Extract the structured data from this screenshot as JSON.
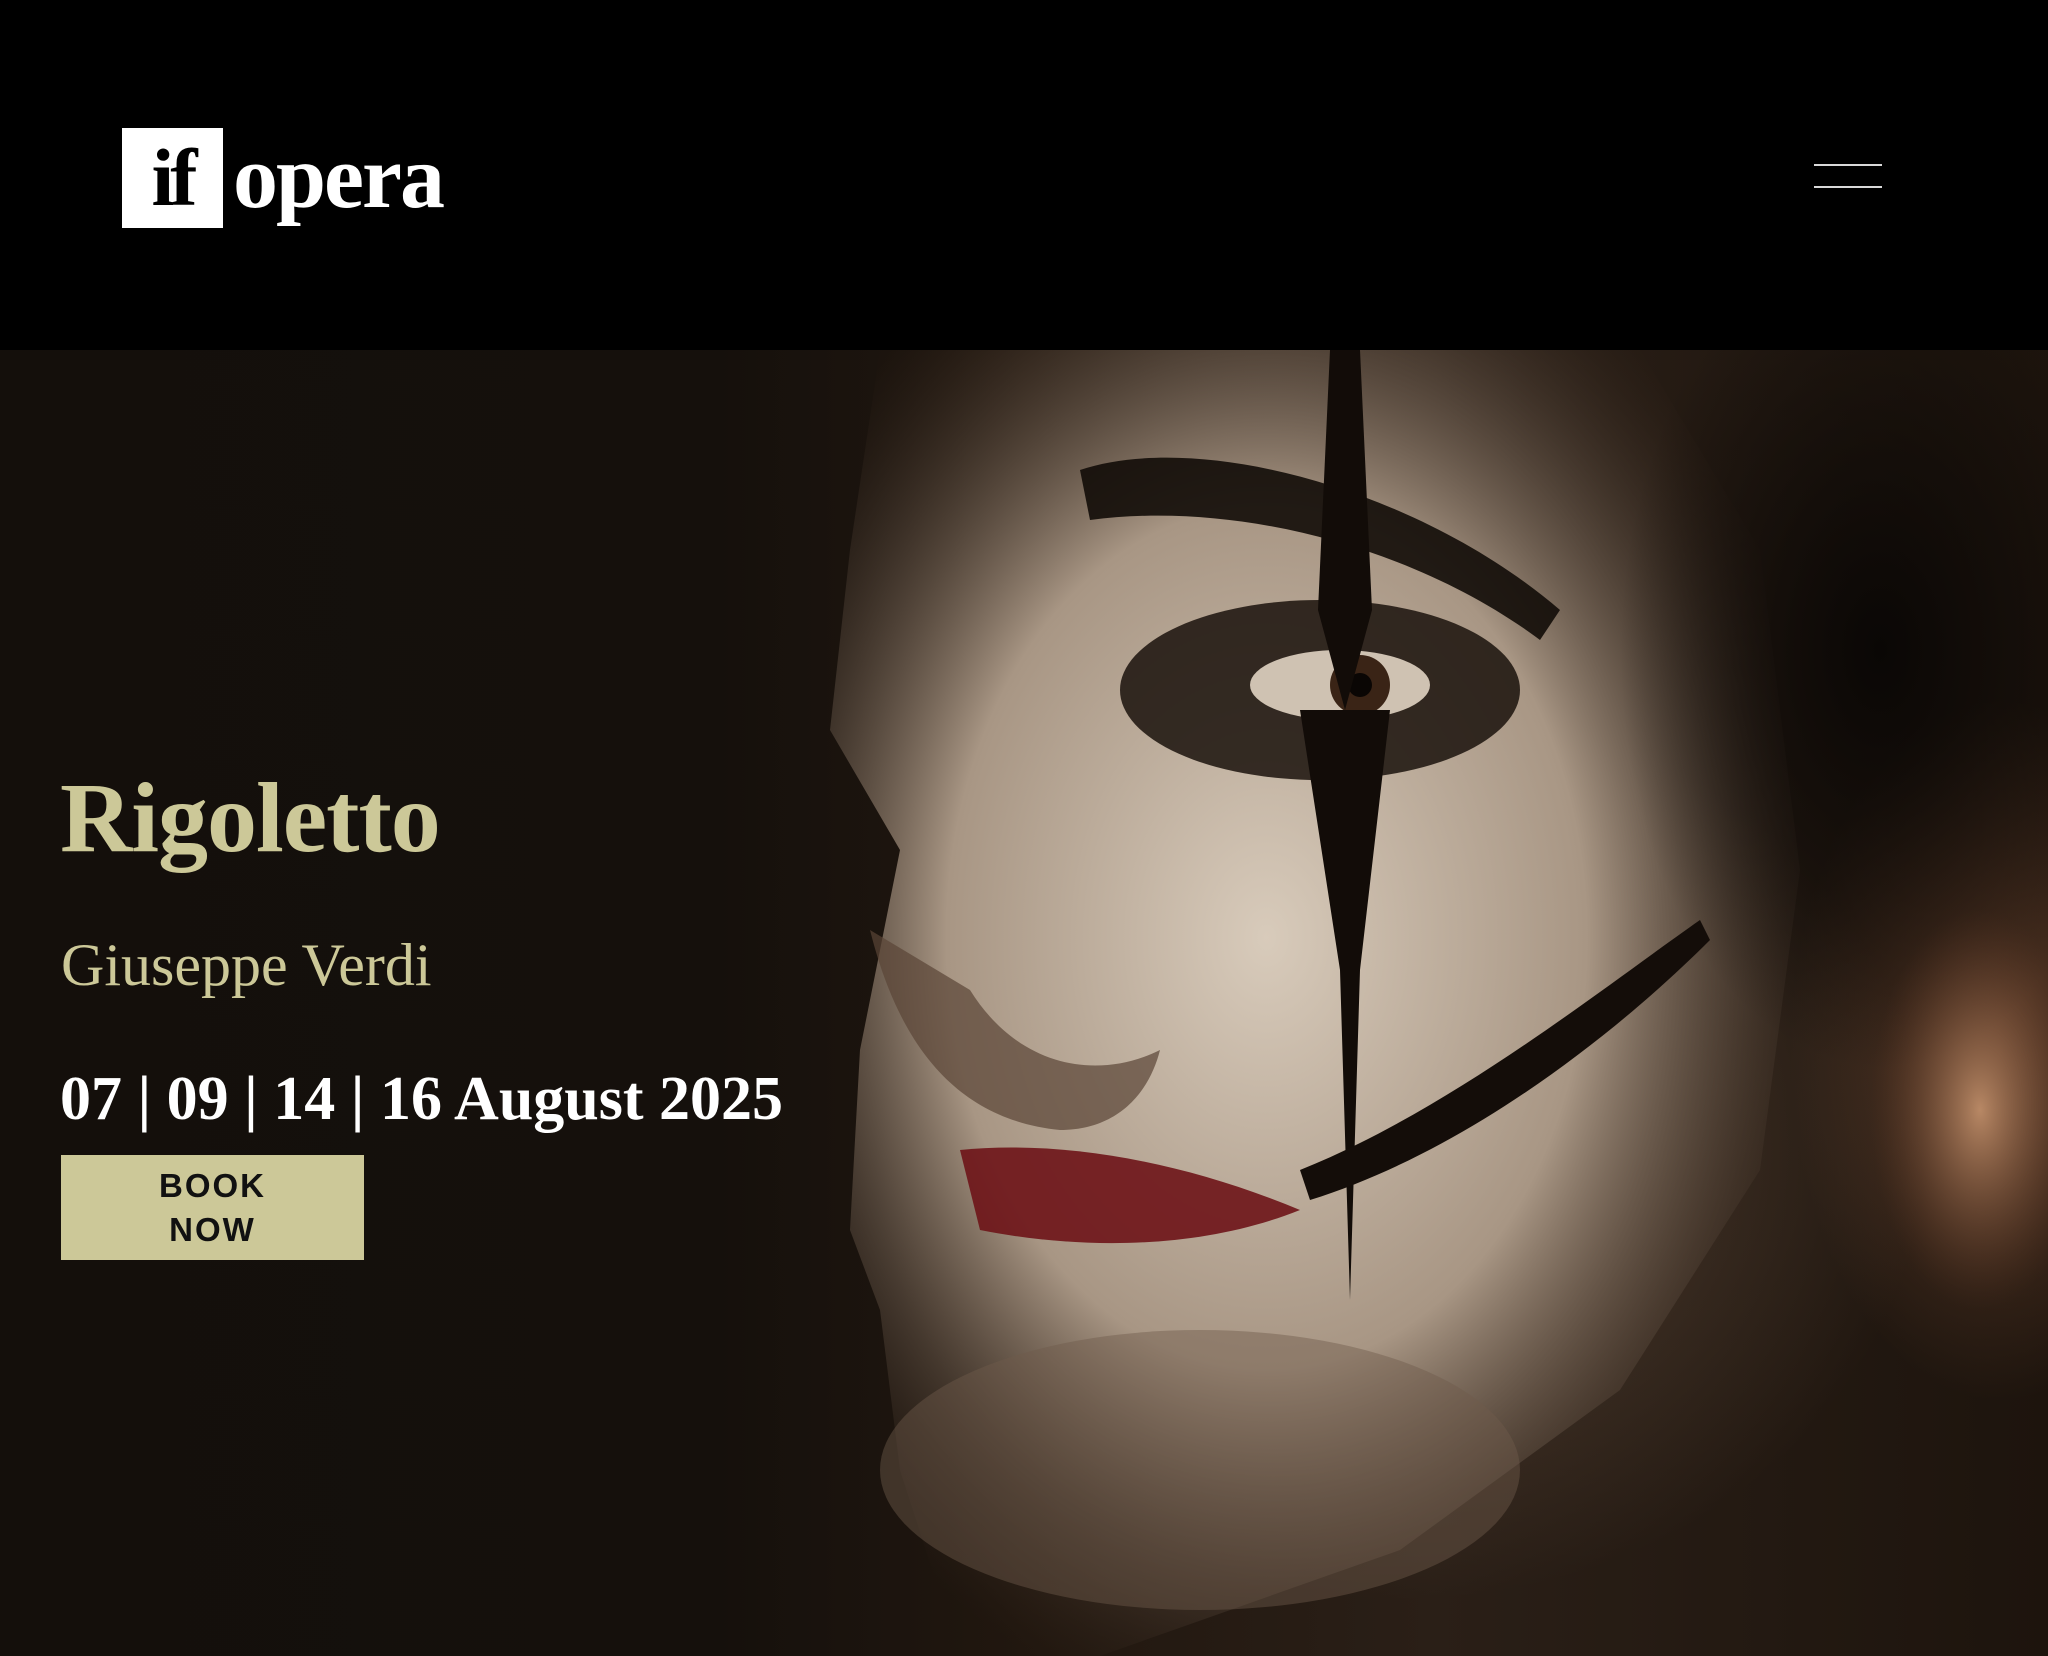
{
  "header": {
    "logo": {
      "mark": "if",
      "word": "opera"
    },
    "menu_icon": "hamburger-menu-icon"
  },
  "hero": {
    "title": "Rigoletto",
    "composer": "Giuseppe Verdi",
    "dates": "07 | 09 | 14 | 16 August 2025",
    "book_label": "BOOK NOW",
    "background_image": "clown-makeup-portrait"
  },
  "colors": {
    "accent": "#ccc898",
    "header_bg": "#000000",
    "text_white": "#ffffff"
  }
}
